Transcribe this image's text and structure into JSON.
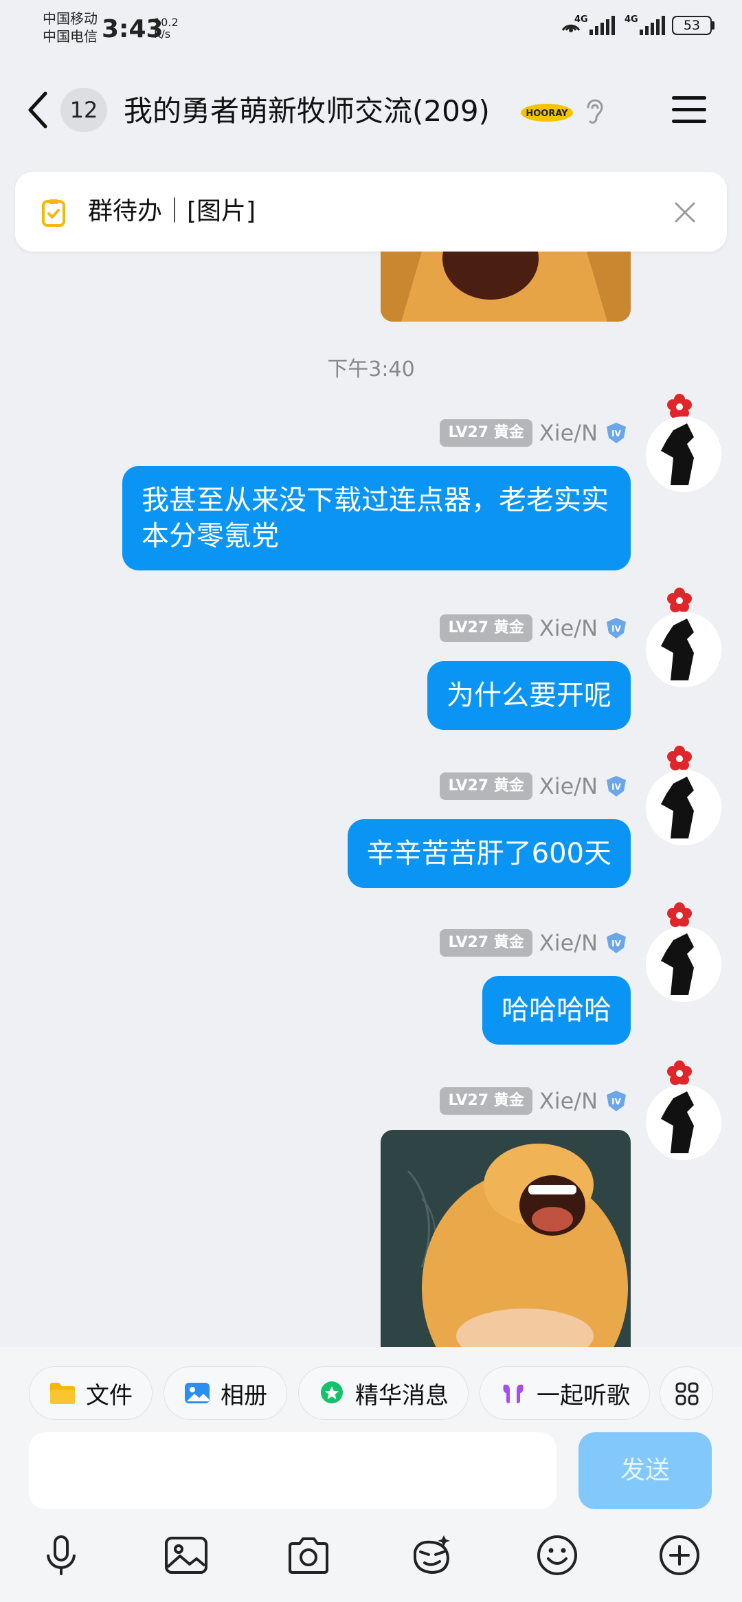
{
  "status_bar": {
    "carrier_1": "中国移动",
    "carrier_2": "中国电信",
    "time": "3:43",
    "net_speed_value": "10.2",
    "net_speed_unit": "K/s",
    "network_1": "4G",
    "network_2": "4G",
    "battery": "53"
  },
  "header": {
    "unread_count": "12",
    "title": "我的勇者萌新牧师交流(209)",
    "badge_text": "HOORAY"
  },
  "todo_banner": {
    "text": "群待办｜[图片]"
  },
  "chat": {
    "time_separator": "下午3:40",
    "sender": {
      "level": "LV27 黄金",
      "nickname": "Xie/N"
    },
    "messages": [
      {
        "type": "text",
        "text": "我甚至从来没下载过连点器，老老实实本分零氪党"
      },
      {
        "type": "text",
        "text": "为什么要开呢"
      },
      {
        "type": "text",
        "text": "辛辛苦苦肝了600天"
      },
      {
        "type": "text",
        "text": "哈哈哈哈"
      },
      {
        "type": "image",
        "image": "laughing-sticker"
      }
    ]
  },
  "toolbar": {
    "chips": [
      {
        "label": "文件",
        "icon": "folder-icon"
      },
      {
        "label": "相册",
        "icon": "photo-icon"
      },
      {
        "label": "精华消息",
        "icon": "star-icon"
      },
      {
        "label": "一起听歌",
        "icon": "earbuds-icon"
      }
    ],
    "send_label": "发送",
    "input_placeholder": "",
    "bottom_icons": [
      "mic-icon",
      "image-icon",
      "camera-icon",
      "sticker-icon",
      "emoji-icon",
      "plus-icon"
    ]
  },
  "colors": {
    "bubble": "#0a95f5",
    "send_disabled": "#82c8fb",
    "background": "#eef0f4"
  }
}
